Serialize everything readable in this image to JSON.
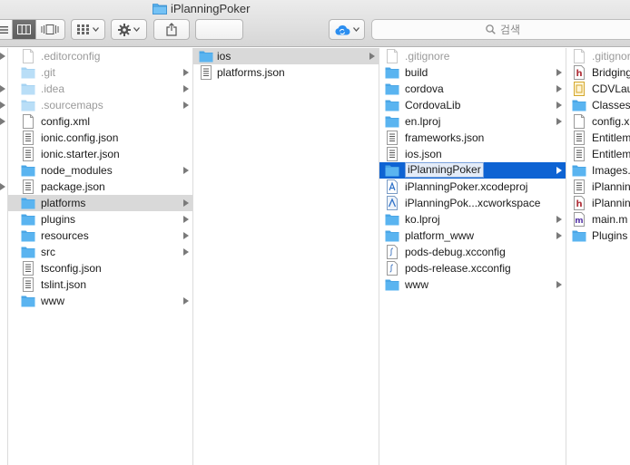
{
  "window": {
    "title": "iPlanningPoker"
  },
  "search": {
    "placeholder": "검색"
  },
  "columns": {
    "prev": {
      "items": [
        {
          "arrow": true
        },
        {
          "arrow": false
        },
        {
          "arrow": true
        },
        {
          "arrow": true
        },
        {
          "arrow": true
        },
        {
          "arrow": false
        },
        {
          "arrow": false
        },
        {
          "arrow": false
        },
        {
          "arrow": true
        },
        {
          "arrow": false
        }
      ]
    },
    "project": {
      "items": [
        {
          "name": ".editorconfig",
          "type": "file",
          "arrow": false,
          "dim": true
        },
        {
          "name": ".git",
          "type": "folder",
          "arrow": true,
          "dim": true
        },
        {
          "name": ".idea",
          "type": "folder",
          "arrow": true,
          "dim": true
        },
        {
          "name": ".sourcemaps",
          "type": "folder",
          "arrow": true,
          "dim": true
        },
        {
          "name": "config.xml",
          "type": "file",
          "arrow": false
        },
        {
          "name": "ionic.config.json",
          "type": "json",
          "arrow": false
        },
        {
          "name": "ionic.starter.json",
          "type": "json",
          "arrow": false
        },
        {
          "name": "node_modules",
          "type": "folder",
          "arrow": true
        },
        {
          "name": "package.json",
          "type": "json",
          "arrow": false
        },
        {
          "name": "platforms",
          "type": "folder",
          "arrow": true,
          "selected": "grey"
        },
        {
          "name": "plugins",
          "type": "folder",
          "arrow": true
        },
        {
          "name": "resources",
          "type": "folder",
          "arrow": true
        },
        {
          "name": "src",
          "type": "folder",
          "arrow": true
        },
        {
          "name": "tsconfig.json",
          "type": "json",
          "arrow": false
        },
        {
          "name": "tslint.json",
          "type": "json",
          "arrow": false
        },
        {
          "name": "www",
          "type": "folder",
          "arrow": true
        }
      ]
    },
    "platforms": {
      "items": [
        {
          "name": "ios",
          "type": "folder",
          "arrow": true,
          "selected": "grey"
        },
        {
          "name": "platforms.json",
          "type": "json",
          "arrow": false
        }
      ]
    },
    "ios": {
      "items": [
        {
          "name": ".gitignore",
          "type": "file",
          "arrow": false,
          "dim": true
        },
        {
          "name": "build",
          "type": "folder",
          "arrow": true
        },
        {
          "name": "cordova",
          "type": "folder",
          "arrow": true
        },
        {
          "name": "CordovaLib",
          "type": "folder",
          "arrow": true
        },
        {
          "name": "en.lproj",
          "type": "folder",
          "arrow": true
        },
        {
          "name": "frameworks.json",
          "type": "json",
          "arrow": false
        },
        {
          "name": "ios.json",
          "type": "json",
          "arrow": false
        },
        {
          "name": "iPlanningPoker",
          "type": "folder",
          "arrow": true,
          "selected": "blue"
        },
        {
          "name": "iPlanningPoker.xcodeproj",
          "type": "xcodeproj",
          "arrow": false
        },
        {
          "name": "iPlanningPok...xcworkspace",
          "type": "xcworkspace",
          "arrow": false
        },
        {
          "name": "ko.lproj",
          "type": "folder",
          "arrow": true
        },
        {
          "name": "platform_www",
          "type": "folder",
          "arrow": true
        },
        {
          "name": "pods-debug.xcconfig",
          "type": "xcconfig",
          "arrow": false
        },
        {
          "name": "pods-release.xcconfig",
          "type": "xcconfig",
          "arrow": false
        },
        {
          "name": "www",
          "type": "folder",
          "arrow": true
        }
      ]
    },
    "app": {
      "items": [
        {
          "name": ".gitignore",
          "type": "file",
          "dim": true
        },
        {
          "name": "Bridging",
          "type": "header"
        },
        {
          "name": "CDVLau",
          "type": "storyboard"
        },
        {
          "name": "Classes",
          "type": "folder"
        },
        {
          "name": "config.x",
          "type": "file"
        },
        {
          "name": "Entitlem",
          "type": "json"
        },
        {
          "name": "Entitlem",
          "type": "json"
        },
        {
          "name": "Images.",
          "type": "folder"
        },
        {
          "name": "iPlannin",
          "type": "json"
        },
        {
          "name": "iPlannin",
          "type": "header"
        },
        {
          "name": "main.m",
          "type": "objc"
        },
        {
          "name": "Plugins",
          "type": "folder"
        }
      ]
    }
  },
  "colors": {
    "folder": "#5ab4f0",
    "selection_blue": "#0e63d3",
    "selection_grey": "#d9d9d9"
  }
}
